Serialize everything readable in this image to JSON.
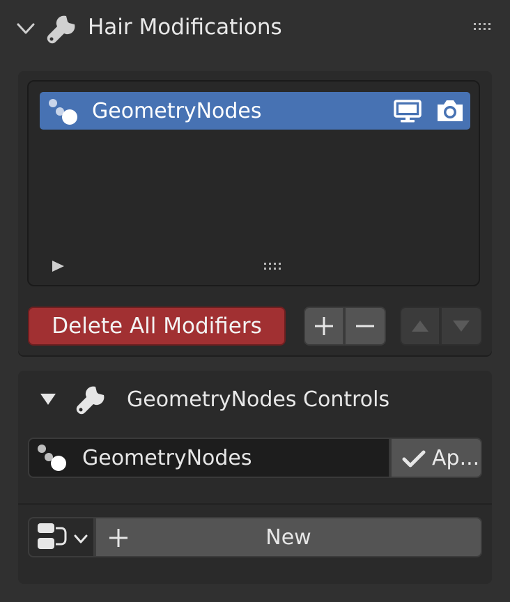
{
  "header": {
    "title": "Hair Modifications",
    "icons": [
      "chevron-down-icon",
      "wrench-icon",
      "drag-grip-icon"
    ]
  },
  "modifier_list": {
    "items": [
      {
        "label": "GeometryNodes",
        "selected": true,
        "icons": [
          "geometry-nodes-icon",
          "monitor-icon",
          "camera-icon"
        ]
      }
    ]
  },
  "actions": {
    "delete_all_label": "Delete All Modifiers",
    "delete_color": "#a13032",
    "icons": [
      "plus-icon",
      "minus-icon",
      "arrow-up-icon",
      "arrow-down-icon"
    ]
  },
  "controls_panel": {
    "title": "GeometryNodes Controls",
    "node_group_value": "GeometryNodes",
    "apply_label": "Ap..."
  },
  "template": {
    "new_label": "New"
  },
  "colors": {
    "accent": "#4772b3",
    "background": "#303030",
    "panel": "#2a2a2a"
  }
}
